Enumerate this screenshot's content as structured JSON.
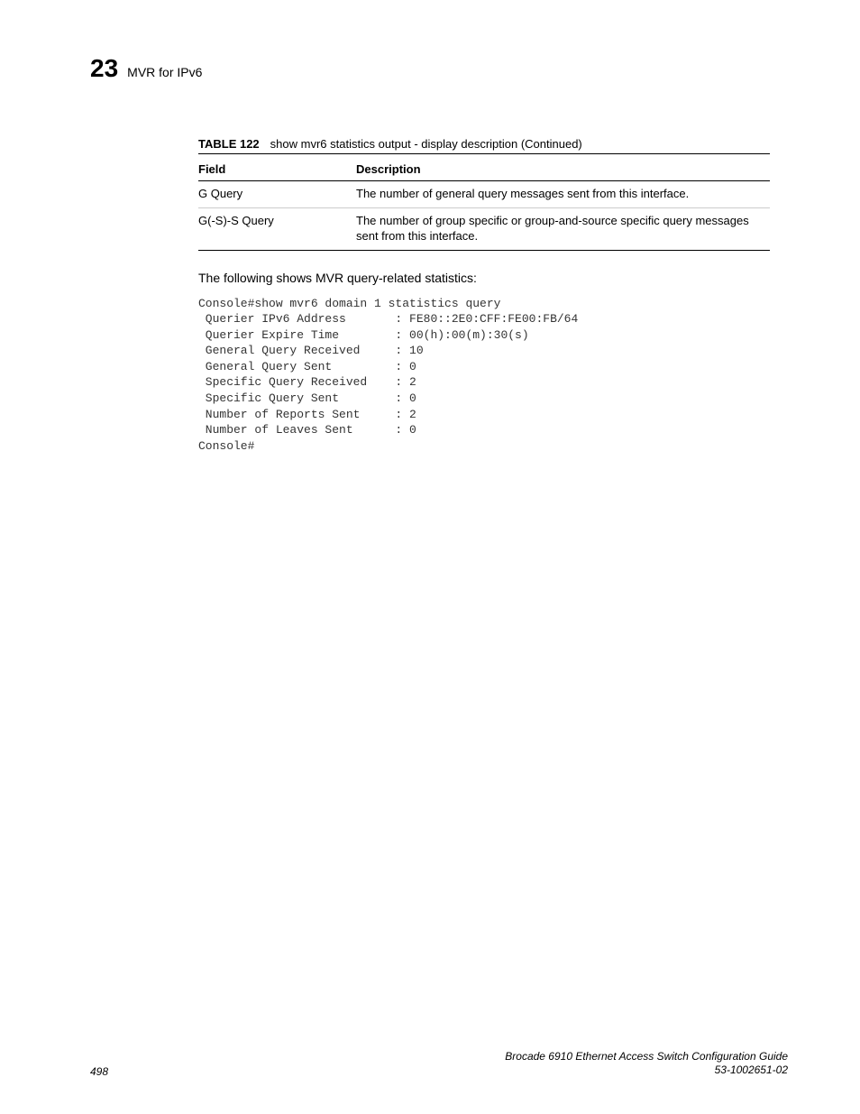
{
  "header": {
    "chapter_num": "23",
    "chapter_title": "MVR for IPv6"
  },
  "table": {
    "label": "TABLE 122",
    "caption": "show mvr6 statistics output - display description (Continued)",
    "columns": {
      "field": "Field",
      "desc": "Description"
    },
    "rows": [
      {
        "field": "G Query",
        "desc": "The number of general query messages sent from this interface."
      },
      {
        "field": "G(-S)-S Query",
        "desc": "The number of group specific or group-and-source specific query messages sent from this interface."
      }
    ]
  },
  "intro": "The following shows MVR query-related statistics:",
  "console": "Console#show mvr6 domain 1 statistics query\n Querier IPv6 Address       : FE80::2E0:CFF:FE00:FB/64\n Querier Expire Time        : 00(h):00(m):30(s)\n General Query Received     : 10\n General Query Sent         : 0\n Specific Query Received    : 2\n Specific Query Sent        : 0\n Number of Reports Sent     : 2\n Number of Leaves Sent      : 0\nConsole#",
  "footer": {
    "page": "498",
    "doc_title": "Brocade 6910 Ethernet Access Switch Configuration Guide",
    "doc_id": "53-1002651-02"
  }
}
